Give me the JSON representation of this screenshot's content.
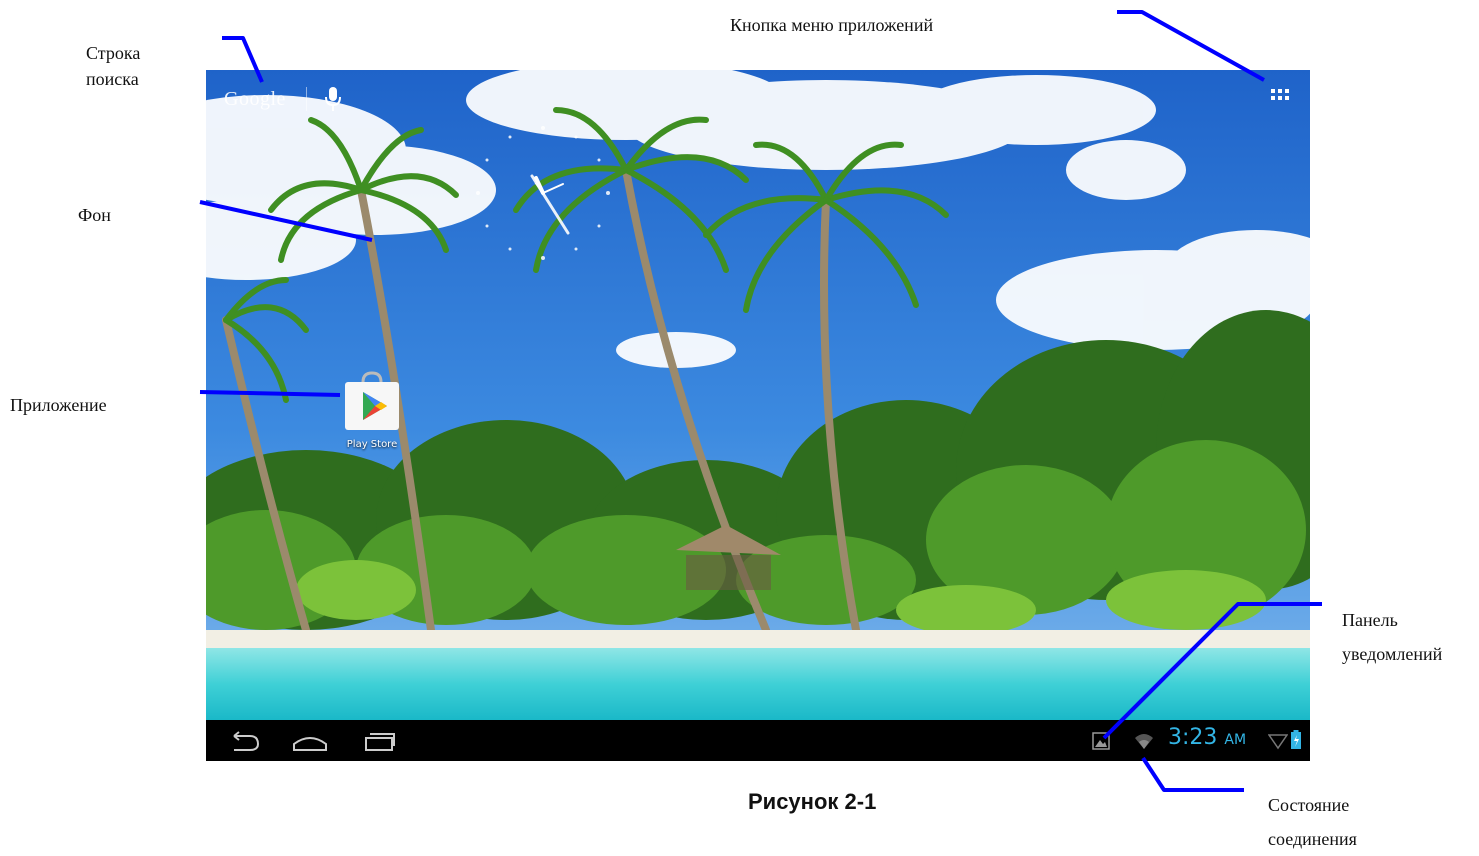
{
  "callouts": {
    "search_bar": [
      "Строка",
      "поиска"
    ],
    "apps_menu_button": "Кнопка меню приложений",
    "background": "Фон",
    "application": "Приложение",
    "notification_panel": [
      "Панель",
      "уведомлений"
    ],
    "connection_status": [
      "Состояние",
      "соединения"
    ]
  },
  "screen": {
    "search": {
      "logo_text": "Google",
      "mic_icon": "microphone-icon"
    },
    "apps_button_icon": "grid-icon",
    "apps": [
      {
        "label": "Play Store",
        "icon": "play-store-icon"
      }
    ],
    "statusbar": {
      "time": "3:23",
      "ampm": "AM",
      "notification_icon": "picture-icon",
      "connection_icon": "wifi-icon"
    },
    "navbar": {
      "back_icon": "back-icon",
      "home_icon": "home-icon",
      "recent_icon": "recent-apps-icon"
    }
  },
  "figure_caption": "Рисунок 2-1",
  "colors": {
    "callout_lines": "#0000ff",
    "status_accent": "#33b5e5",
    "navbar_bg": "#000000"
  }
}
